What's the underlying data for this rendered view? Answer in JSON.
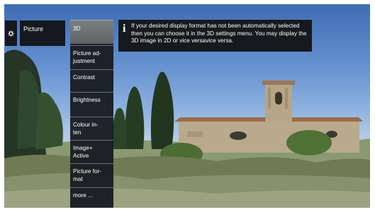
{
  "breadcrumb": {
    "settings_icon": "gear-icon",
    "picture_label": "Picture"
  },
  "menu": {
    "items": [
      {
        "label": "3D",
        "selected": true
      },
      {
        "label": "Picture ad-justment",
        "selected": false
      },
      {
        "label": "Contrast",
        "selected": false
      },
      {
        "label": "Brightness",
        "selected": false
      },
      {
        "label": "Colour in-ten",
        "selected": false
      },
      {
        "label": "Image+ Active",
        "selected": false
      },
      {
        "label": "Picture for-mat",
        "selected": false
      },
      {
        "label": "more ...",
        "selected": false
      }
    ]
  },
  "info": {
    "icon": "info-icon",
    "text": "If your desired display format has not been automatically selected then you can choose it in the 3D settings menu. You may display the 3D image in 2D or vice versavice versa."
  },
  "colors": {
    "panel_bg": "#16191e",
    "selected_bg": "#6e7173",
    "divider": "#6b6e73"
  }
}
